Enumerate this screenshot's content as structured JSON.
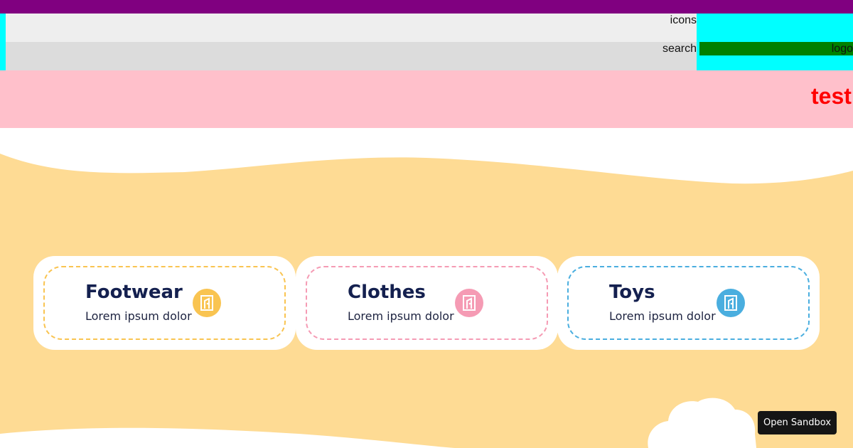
{
  "header": {
    "icons_label": "icons",
    "search_label": "search",
    "logo_label": "logo"
  },
  "banner": {
    "text": "test"
  },
  "colors": {
    "topbar": "#800080",
    "header_bg": "#00ffff",
    "logo_bg": "#008000",
    "banner_bg": "#ffc0cb",
    "banner_text": "#ff0000",
    "sand": "#fedb94"
  },
  "categories": [
    {
      "title": "Footwear",
      "subtitle": "Lorem ipsum dolor",
      "color": "#f9c451",
      "icon": "door-icon"
    },
    {
      "title": "Clothes",
      "subtitle": "Lorem ipsum dolor",
      "color": "#f59bb4",
      "icon": "door-icon"
    },
    {
      "title": "Toys",
      "subtitle": "Lorem ipsum dolor",
      "color": "#4aaedf",
      "icon": "door-icon"
    }
  ],
  "sandbox_button": {
    "label": "Open Sandbox"
  }
}
